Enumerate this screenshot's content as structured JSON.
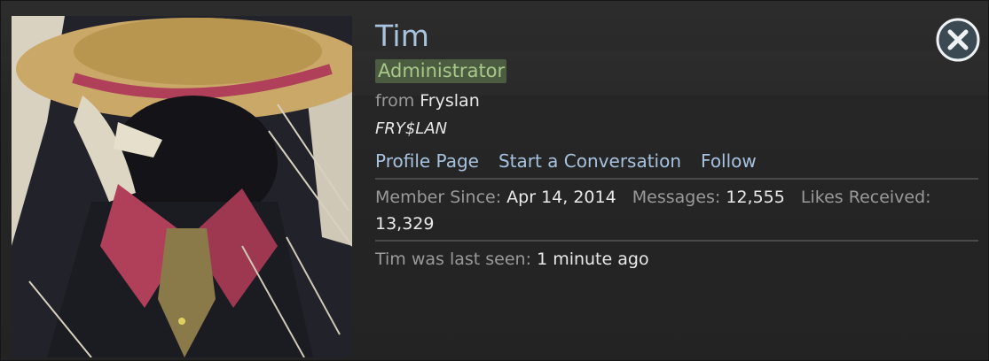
{
  "profile": {
    "username": "Tim",
    "role": "Administrator",
    "from_label": "from",
    "location": "Fryslan",
    "custom_title": "FRY$LAN"
  },
  "links": {
    "profile_page": "Profile Page",
    "start_conversation": "Start a Conversation",
    "follow": "Follow"
  },
  "stats": {
    "member_since_label": "Member Since:",
    "member_since_value": "Apr 14, 2014",
    "messages_label": "Messages:",
    "messages_value": "12,555",
    "likes_label": "Likes Received:",
    "likes_value": "13,329"
  },
  "last_seen": {
    "label": "Tim was last seen:",
    "value": "1 minute ago"
  },
  "icons": {
    "close": "close-icon"
  },
  "colors": {
    "username": "#a9c4e0",
    "role_text": "#a8c98a",
    "role_highlight": "#4b5c40",
    "link": "#a6c2df",
    "muted": "#9a9a9a",
    "value": "#eaeaea"
  }
}
